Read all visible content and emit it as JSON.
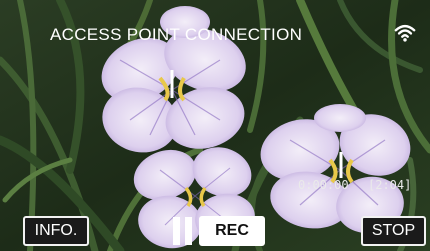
{
  "header": {
    "title": "ACCESS POINT CONNECTION",
    "status_icon": "wifi-icon"
  },
  "recording": {
    "elapsed": "0:00:00",
    "remaining": "[2:04]"
  },
  "controls": {
    "info_label": "INFO.",
    "pause_icon": "pause-icon",
    "rec_label": "REC",
    "stop_label": "STOP"
  },
  "colors": {
    "overlay_text": "#ffffff",
    "button_background": "#1a1a1a",
    "rec_button_background": "#ffffff",
    "foliage": "#2f4a26",
    "petal": "#e6dcf2",
    "petal_vein": "#8a6cc0",
    "flower_center": "#e8c84a"
  }
}
